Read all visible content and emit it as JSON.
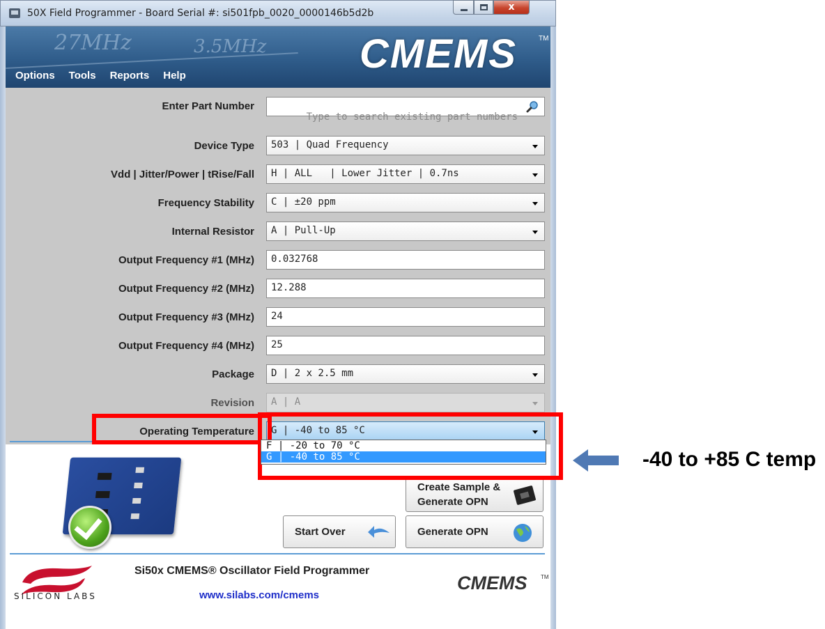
{
  "window": {
    "title": "50X Field Programmer - Board Serial #: si501fpb_0020_0000146b5d2b",
    "close_glyph": "x"
  },
  "header": {
    "brand": "CMEMS",
    "brand_tm": "TM",
    "sketch_a": "27MHz",
    "sketch_b": "3.5MHz"
  },
  "menu": {
    "options": "Options",
    "tools": "Tools",
    "reports": "Reports",
    "help": "Help"
  },
  "form": {
    "part_number": {
      "label": "Enter Part Number",
      "placeholder": "Type to search existing part numbers"
    },
    "device_type": {
      "label": "Device Type",
      "value": "503 | Quad Frequency"
    },
    "vdd": {
      "label": "Vdd | Jitter/Power | tRise/Fall",
      "value": "H | ALL   | Lower Jitter | 0.7ns"
    },
    "stability": {
      "label": "Frequency Stability",
      "value": "C | ±20 ppm"
    },
    "resistor": {
      "label": "Internal Resistor",
      "value": "A | Pull-Up"
    },
    "freq1": {
      "label": "Output Frequency #1 (MHz)",
      "value": "0.032768"
    },
    "freq2": {
      "label": "Output Frequency #2 (MHz)",
      "value": "12.288"
    },
    "freq3": {
      "label": "Output Frequency #3 (MHz)",
      "value": "24"
    },
    "freq4": {
      "label": "Output Frequency #4 (MHz)",
      "value": "25"
    },
    "package": {
      "label": "Package",
      "value": "D | 2 x 2.5 mm"
    },
    "revision": {
      "label": "Revision",
      "value": "A | A"
    },
    "temperature": {
      "label": "Operating Temperature",
      "value": "G | -40 to 85 °C",
      "options": [
        "F | -20 to 70 °C",
        "G | -40 to 85 °C"
      ],
      "selected_option": "G | -40 to 85 °C"
    }
  },
  "buttons": {
    "create_sample_line1": "Create Sample &",
    "create_sample_line2": "Generate OPN",
    "start_over": "Start Over",
    "generate_opn": "Generate OPN"
  },
  "footer": {
    "title": "Si50x CMEMS® Oscillator Field Programmer",
    "link": "www.silabs.com/cmems",
    "silabs": "SILICON LABS",
    "cmems": "CMEMS",
    "cmems_tm": "TM"
  },
  "annotation": {
    "text": "-40 to +85 C temp"
  },
  "colors": {
    "highlight_red": "#ff0000",
    "selection_blue": "#3399ff",
    "link_blue": "#1f2fc9",
    "arrow_blue": "#4f79b4"
  }
}
